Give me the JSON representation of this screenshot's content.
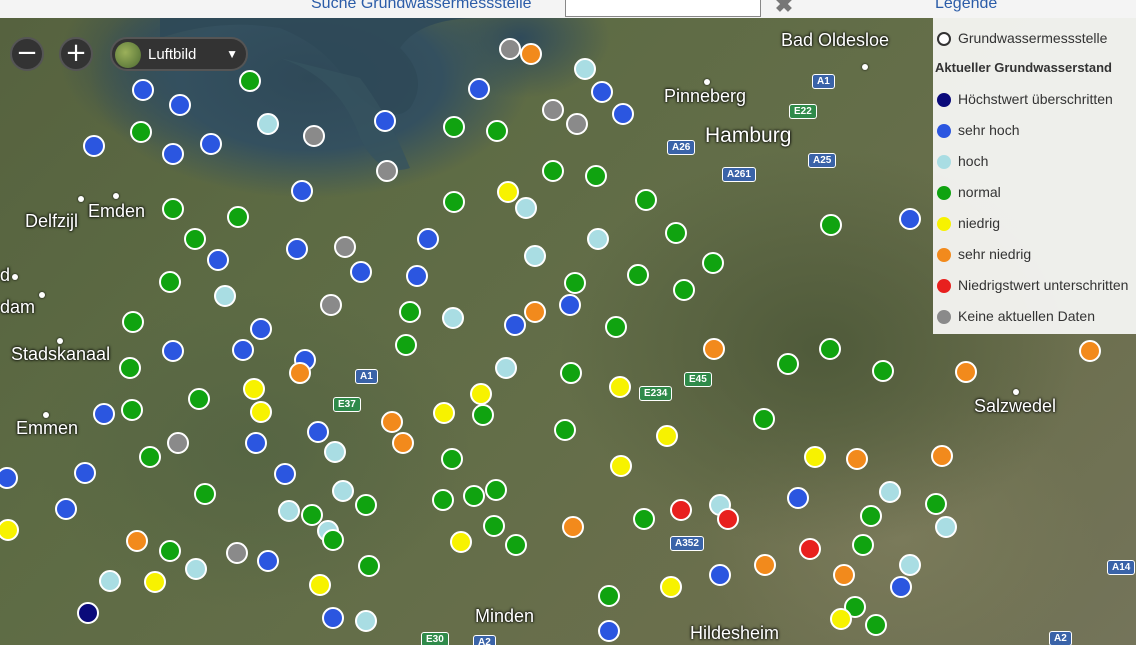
{
  "search": {
    "label": "Suche Grundwassermessstelle",
    "value": "",
    "clear_icon": "close-icon"
  },
  "legend": {
    "title": "Legende",
    "station_label": "Grundwassermessstelle",
    "heading": "Aktueller Grundwasserstand",
    "items": [
      {
        "key": "hoechst",
        "label": "Höchstwert überschritten",
        "color": "#0a0a7a"
      },
      {
        "key": "sehr_hoch",
        "label": "sehr hoch",
        "color": "#2b56e0"
      },
      {
        "key": "hoch",
        "label": "hoch",
        "color": "#a9dde3"
      },
      {
        "key": "normal",
        "label": "normal",
        "color": "#10a310"
      },
      {
        "key": "niedrig",
        "label": "niedrig",
        "color": "#f7f200"
      },
      {
        "key": "sehr_niedrig",
        "label": "sehr niedrig",
        "color": "#f28a1c"
      },
      {
        "key": "niedrigst",
        "label": "Niedrigstwert unterschritten",
        "color": "#e8201e"
      },
      {
        "key": "keine",
        "label": "Keine aktuellen Daten",
        "color": "#8a8a8a"
      }
    ]
  },
  "controls": {
    "zoom_out": "−",
    "zoom_in": "+",
    "layer_label": "Luftbild",
    "layer_icon": "globe-icon",
    "caret_icon": "chevron-down-icon"
  },
  "cities": {
    "bad_oldesloe": "Bad Oldesloe",
    "pinneberg": "Pinneberg",
    "hamburg": "Hamburg",
    "delfzijl": "Delfzijl",
    "emden": "Emden",
    "d": "d",
    "dam": "dam",
    "stadskanaal": "Stadskanaal",
    "emmen": "Emmen",
    "salzwedel": "Salzwedel",
    "minden": "Minden",
    "hildesheim": "Hildesheim"
  },
  "roads": {
    "a1_n": "A1",
    "e22": "E22",
    "a26": "A26",
    "a25": "A25",
    "a261": "A261",
    "a1_s": "A1",
    "e37": "E37",
    "e234": "E234",
    "e45": "E45",
    "a352": "A352",
    "a14": "A14",
    "e30": "E30",
    "a2": "A2",
    "a2_e": "A2"
  }
}
